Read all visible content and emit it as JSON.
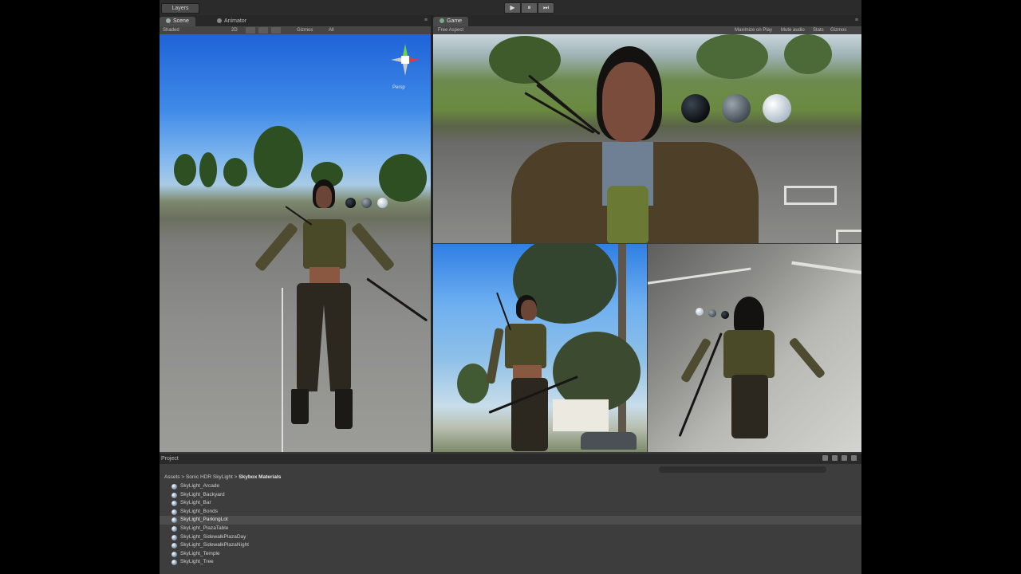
{
  "toolbar": {
    "layers_label": "Layers"
  },
  "play_controls": {
    "play": "▶",
    "pause": "⏸",
    "step": "⏭"
  },
  "scene_tabs": {
    "scene": "Scene",
    "animator": "Animator"
  },
  "scene_toolbar": {
    "shading": "Shaded",
    "mode_2d": "2D",
    "gizmos": "Gizmos",
    "search": "All"
  },
  "gizmo": {
    "label": "Persp"
  },
  "game_tab": {
    "game": "Game"
  },
  "game_toolbar": {
    "aspect": "Free Aspect",
    "maximize": "Maximize on Play",
    "mute": "Mute audio",
    "stats": "Stats",
    "gizmos": "Gizmos"
  },
  "project": {
    "tab": "Project",
    "breadcrumb": {
      "root": "Assets",
      "folder": "Sonic HDR SkyLight",
      "current": "Skybox Materials"
    },
    "assets": [
      "SkyLight_Arcade",
      "SkyLight_Backyard",
      "SkyLight_Bar",
      "SkyLight_Bonds",
      "SkyLight_ParkingLot",
      "SkyLight_PlazaTable",
      "SkyLight_SidewalkPlazaDay",
      "SkyLight_SidewalkPlazaNight",
      "SkyLight_Temple",
      "SkyLight_Tree"
    ],
    "selected_index": 4
  },
  "colors": {
    "editor_bg": "#3a3a3a",
    "toolbar_bg": "#2b2b2b",
    "selection": "#4d4d4d"
  }
}
